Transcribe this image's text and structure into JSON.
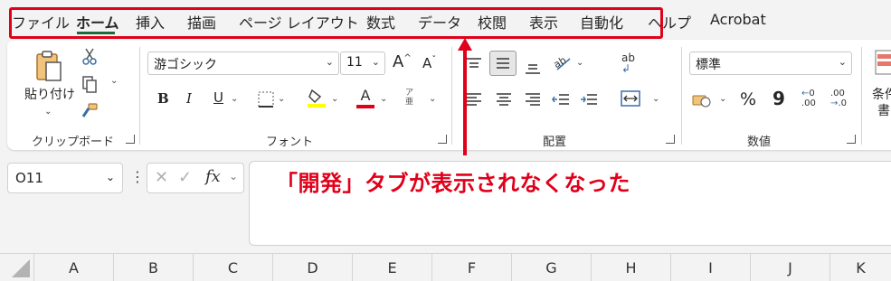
{
  "tabs": [
    {
      "label": "ファイル",
      "active": false
    },
    {
      "label": "ホーム",
      "active": true
    },
    {
      "label": "挿入",
      "active": false
    },
    {
      "label": "描画",
      "active": false
    },
    {
      "label": "ページ レイアウト",
      "active": false
    },
    {
      "label": "数式",
      "active": false
    },
    {
      "label": "データ",
      "active": false
    },
    {
      "label": "校閲",
      "active": false
    },
    {
      "label": "表示",
      "active": false
    },
    {
      "label": "自動化",
      "active": false
    },
    {
      "label": "ヘルプ",
      "active": false
    },
    {
      "label": "Acrobat",
      "active": false
    }
  ],
  "ribbon": {
    "clipboard": {
      "label": "クリップボード",
      "paste_label": "貼り付け"
    },
    "font": {
      "label": "フォント",
      "font_name": "游ゴシック",
      "font_size": "11",
      "phonetic_glyph_top": "ア",
      "phonetic_glyph_bottom": "亜",
      "bold_glyph": "B",
      "italic_glyph": "I",
      "underline_glyph": "U",
      "font_color_glyph": "A",
      "grow_glyph": "A",
      "shrink_glyph": "A"
    },
    "alignment": {
      "label": "配置",
      "wrap_glyph": "ab"
    },
    "number": {
      "label": "数値",
      "format": "標準",
      "percent_glyph": "%",
      "comma_glyph": "9"
    },
    "styles": {
      "partial_label_1": "条件",
      "partial_label_2": "書"
    }
  },
  "formula_bar": {
    "name_box": "O11",
    "fx_label": "fx",
    "formula": ""
  },
  "annotation_text": "「開発」タブが表示されなくなった",
  "columns": [
    "A",
    "B",
    "C",
    "D",
    "E",
    "F",
    "G",
    "H",
    "I",
    "J",
    "K"
  ],
  "colors": {
    "highlight_red": "#e0001a",
    "excel_green": "#1d6b3a"
  }
}
